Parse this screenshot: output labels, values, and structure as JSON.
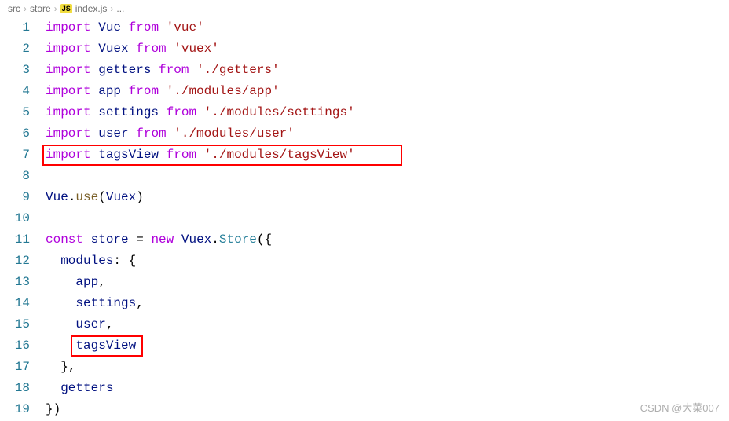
{
  "breadcrumbs": {
    "part0": "src",
    "part1": "store",
    "js_label": "JS",
    "part2": "index.js",
    "part3": "..."
  },
  "lines": {
    "l1": {
      "num": "1",
      "a": "import",
      "b": "Vue",
      "c": "from",
      "d": "'vue'"
    },
    "l2": {
      "num": "2",
      "a": "import",
      "b": "Vuex",
      "c": "from",
      "d": "'vuex'"
    },
    "l3": {
      "num": "3",
      "a": "import",
      "b": "getters",
      "c": "from",
      "d": "'./getters'"
    },
    "l4": {
      "num": "4",
      "a": "import",
      "b": "app",
      "c": "from",
      "d": "'./modules/app'"
    },
    "l5": {
      "num": "5",
      "a": "import",
      "b": "settings",
      "c": "from",
      "d": "'./modules/settings'"
    },
    "l6": {
      "num": "6",
      "a": "import",
      "b": "user",
      "c": "from",
      "d": "'./modules/user'"
    },
    "l7": {
      "num": "7",
      "a": "import",
      "b": "tagsView",
      "c": "from",
      "d": "'./modules/tagsView'"
    },
    "l8": {
      "num": "8"
    },
    "l9": {
      "num": "9",
      "a": "Vue",
      "b": ".",
      "c": "use",
      "d": "(",
      "e": "Vuex",
      "f": ")"
    },
    "l10": {
      "num": "10"
    },
    "l11": {
      "num": "11",
      "a": "const",
      "b": "store",
      "c": "= ",
      "d": "new",
      "e": "Vuex",
      "f": ".",
      "g": "Store",
      "h": "({"
    },
    "l12": {
      "num": "12",
      "a": "modules",
      "b": ": {"
    },
    "l13": {
      "num": "13",
      "a": "app",
      "b": ","
    },
    "l14": {
      "num": "14",
      "a": "settings",
      "b": ","
    },
    "l15": {
      "num": "15",
      "a": "user",
      "b": ","
    },
    "l16": {
      "num": "16",
      "a": "tagsView"
    },
    "l17": {
      "num": "17",
      "a": "},"
    },
    "l18": {
      "num": "18",
      "a": "getters"
    },
    "l19": {
      "num": "19",
      "a": "})"
    }
  },
  "watermark": "CSDN @大菜007"
}
